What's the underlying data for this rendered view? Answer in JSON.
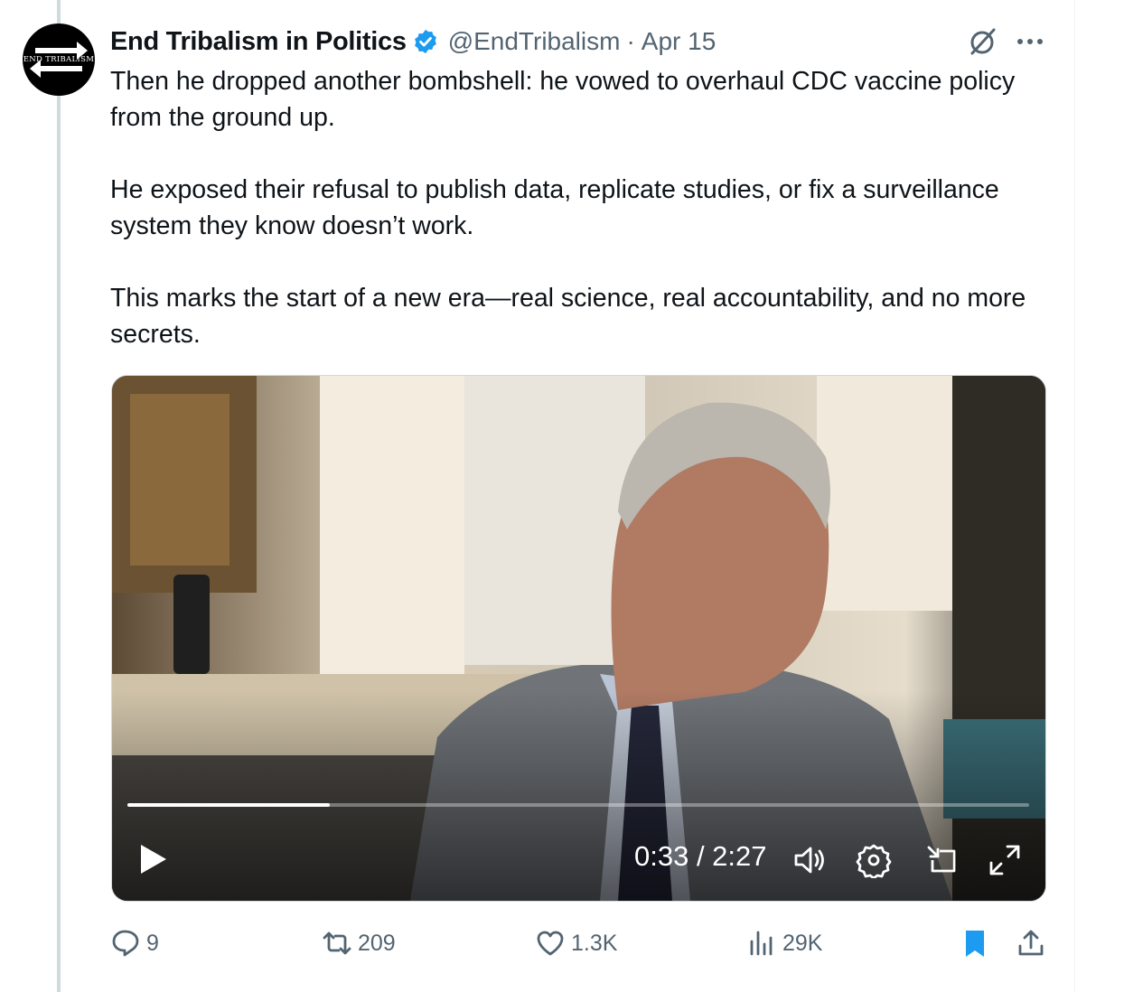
{
  "account": {
    "display_name": "End Tribalism in Politics",
    "handle": "@EndTribalism",
    "separator": "·",
    "date": "Apr 15",
    "avatar_text": "END TRIBALISM"
  },
  "tweet": {
    "paragraphs": [
      "Then he dropped another bombshell: he vowed to overhaul CDC vaccine policy from the ground up.",
      "He exposed their refusal to publish data, replicate studies, or fix a surveillance system they know doesn’t work.",
      "This marks the start of a new era—real science, real accountability, and no more secrets."
    ]
  },
  "video": {
    "time_display": "0:33 / 2:27",
    "progress": 0.2245
  },
  "actions": {
    "replies": "9",
    "reposts": "209",
    "likes": "1.3K",
    "views": "29K"
  },
  "colors": {
    "accent": "#1d9bf0",
    "text": "#0f1419",
    "muted": "#536471"
  },
  "icons": [
    "verified-badge-icon",
    "grok-icon",
    "more-icon",
    "play-icon",
    "volume-icon",
    "settings-icon",
    "pip-icon",
    "fullscreen-icon",
    "reply-icon",
    "repost-icon",
    "like-icon",
    "views-icon",
    "bookmark-icon",
    "share-icon"
  ]
}
